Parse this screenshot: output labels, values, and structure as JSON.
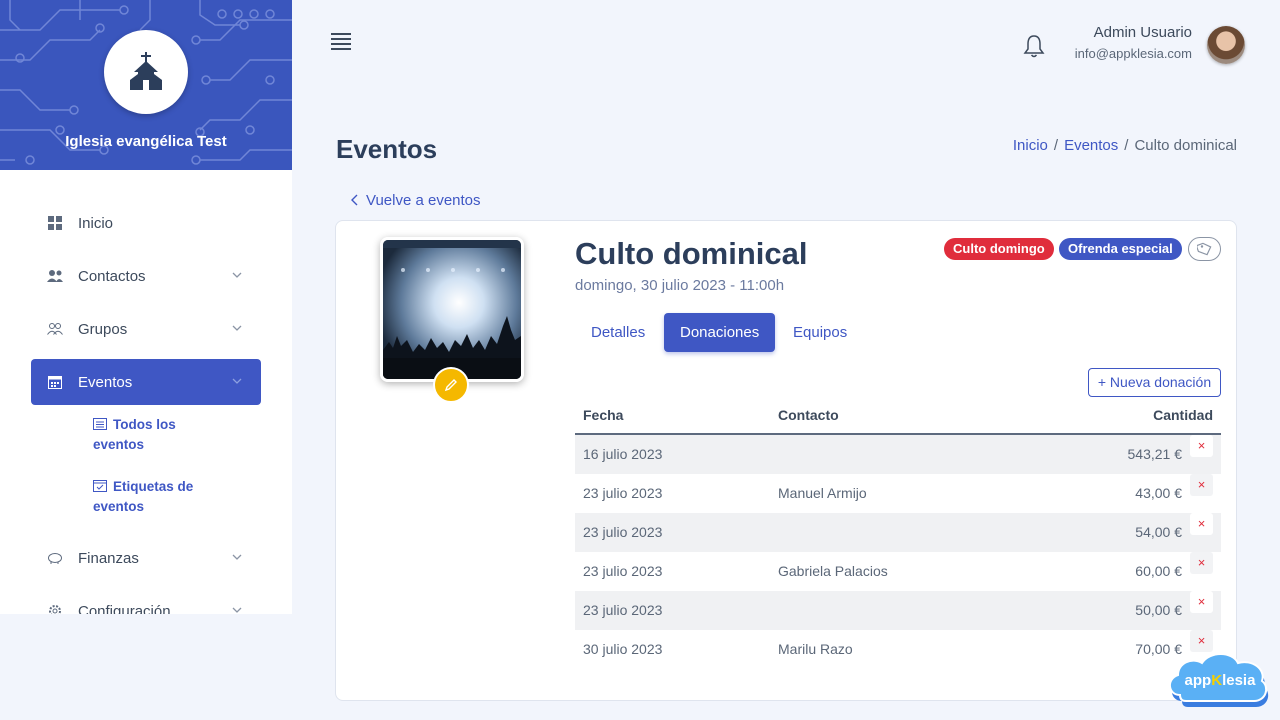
{
  "sidebar": {
    "church_name": "Iglesia evangélica Test",
    "items": [
      {
        "label": "Inicio",
        "icon": "grid-icon"
      },
      {
        "label": "Contactos",
        "icon": "users-icon"
      },
      {
        "label": "Grupos",
        "icon": "group-icon"
      },
      {
        "label": "Eventos",
        "icon": "calendar-icon"
      },
      {
        "label": "Finanzas",
        "icon": "piggy-bank-icon"
      },
      {
        "label": "Configuración",
        "icon": "gear-icon"
      }
    ],
    "subitems": [
      {
        "label": "Todos los eventos",
        "icon": "calendar-list-icon"
      },
      {
        "label": "Etiquetas de eventos",
        "icon": "calendar-check-icon"
      }
    ]
  },
  "header": {
    "user_name": "Admin Usuario",
    "user_email": "info@appklesia.com"
  },
  "page": {
    "title": "Eventos",
    "breadcrumb": [
      "Inicio",
      "Eventos",
      "Culto dominical"
    ],
    "back_label": "Vuelve a eventos"
  },
  "event": {
    "title": "Culto dominical",
    "date": "domingo, 30 julio 2023 - 11:00h",
    "tags": [
      {
        "label": "Culto domingo",
        "color": "#e02d3c"
      },
      {
        "label": "Ofrenda especial",
        "color": "#3f57c4"
      }
    ],
    "tabs": [
      "Detalles",
      "Donaciones",
      "Equipos"
    ],
    "active_tab": "Donaciones",
    "new_donation_label": "+ Nueva donación"
  },
  "donations": {
    "headers": [
      "Fecha",
      "Contacto",
      "Cantidad"
    ],
    "rows": [
      {
        "date": "16 julio 2023",
        "contact": "",
        "amount": "543,21 €"
      },
      {
        "date": "23 julio 2023",
        "contact": "Manuel Armijo",
        "amount": "43,00 €"
      },
      {
        "date": "23 julio 2023",
        "contact": "",
        "amount": "54,00 €"
      },
      {
        "date": "23 julio 2023",
        "contact": "Gabriela Palacios",
        "amount": "60,00 €"
      },
      {
        "date": "23 julio 2023",
        "contact": "",
        "amount": "50,00 €"
      },
      {
        "date": "30 julio 2023",
        "contact": "Marilu Razo",
        "amount": "70,00 €"
      }
    ],
    "delete_label": "×"
  },
  "brand": {
    "prefix": "app",
    "highlight": "K",
    "suffix": "lesia"
  },
  "colors": {
    "primary": "#3f57c4",
    "danger": "#e02d3c",
    "accent": "#f5b800"
  }
}
